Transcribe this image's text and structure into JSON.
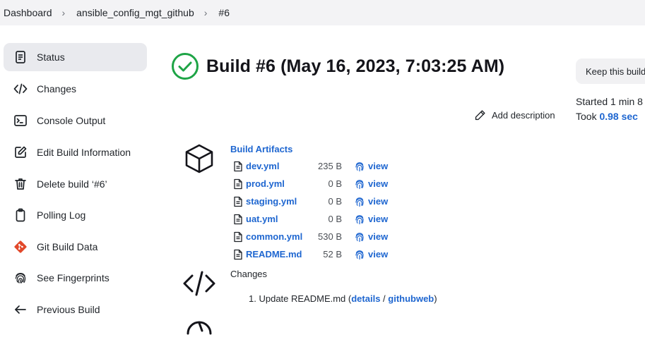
{
  "breadcrumb": {
    "items": [
      "Dashboard",
      "ansible_config_mgt_github",
      "#6"
    ]
  },
  "sidebar": {
    "items": [
      {
        "label": "Status",
        "icon": "status-icon"
      },
      {
        "label": "Changes",
        "icon": "code-icon"
      },
      {
        "label": "Console Output",
        "icon": "terminal-icon"
      },
      {
        "label": "Edit Build Information",
        "icon": "edit-icon"
      },
      {
        "label": "Delete build ‘#6’",
        "icon": "trash-icon"
      },
      {
        "label": "Polling Log",
        "icon": "clipboard-icon"
      },
      {
        "label": "Git Build Data",
        "icon": "git-icon"
      },
      {
        "label": "See Fingerprints",
        "icon": "fingerprint-icon"
      },
      {
        "label": "Previous Build",
        "icon": "arrow-left-icon"
      }
    ]
  },
  "main": {
    "title": "Build #6 (May 16, 2023, 7:03:25 AM)",
    "keep_label": "Keep this build forever",
    "started": "Started 1 min 8",
    "took_prefix": "Took",
    "took_value": "0.98 sec",
    "add_description": "Add description",
    "artifacts_title": "Build Artifacts",
    "artifacts": [
      {
        "name": "dev.yml",
        "size": "235 B",
        "action": "view"
      },
      {
        "name": "prod.yml",
        "size": "0 B",
        "action": "view"
      },
      {
        "name": "staging.yml",
        "size": "0 B",
        "action": "view"
      },
      {
        "name": "uat.yml",
        "size": "0 B",
        "action": "view"
      },
      {
        "name": "common.yml",
        "size": "530 B",
        "action": "view"
      },
      {
        "name": "README.md",
        "size": "52 B",
        "action": "view"
      }
    ],
    "changes_label": "Changes",
    "change": {
      "number": "1.",
      "text": "Update README.md (",
      "details": "details",
      "sep": " / ",
      "githubweb": "githubweb",
      "close": ")"
    }
  },
  "colors": {
    "link": "#1e66d0",
    "success": "#1ea446",
    "git": "#e2482a",
    "active_bg": "#e9eaee"
  }
}
